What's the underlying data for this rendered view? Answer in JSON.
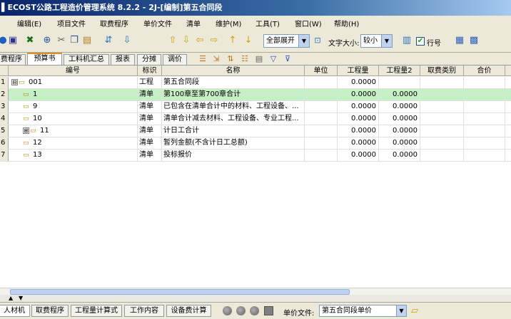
{
  "window": {
    "title": "▌ECOST公路工程造价管理系统 8.2.2 - 2J-[编制]第五合同段"
  },
  "menu": [
    {
      "label": "编辑(E)"
    },
    {
      "label": "项目文件"
    },
    {
      "label": "取费程序"
    },
    {
      "label": "单价文件"
    },
    {
      "label": "清单"
    },
    {
      "label": "维护(M)"
    },
    {
      "label": "工具(T)"
    },
    {
      "label": "窗口(W)"
    },
    {
      "label": "帮助(H)"
    }
  ],
  "toolbar": {
    "expand_select": "全部展开",
    "font_size_label": "文字大小:",
    "font_size_select": "较小",
    "line_number_label": "行号",
    "line_number_checked": "✔"
  },
  "tabs": [
    {
      "label": "费程序"
    },
    {
      "label": "预算书"
    },
    {
      "label": "工料机汇总"
    },
    {
      "label": "报表"
    },
    {
      "label": "分摊"
    },
    {
      "label": "调价"
    }
  ],
  "grid": {
    "columns": [
      "编号",
      "标识",
      "名称",
      "单位",
      "工程量",
      "工程量2",
      "取费类别",
      "合价"
    ],
    "rows": [
      {
        "rownum": "1",
        "code": "001",
        "kind": "工程",
        "name": "第五合同段",
        "unit": "",
        "qty": "0.0000",
        "qty2": "",
        "fee": "",
        "total": "",
        "expander": "⊟"
      },
      {
        "rownum": "2",
        "code": "1",
        "kind": "清单",
        "name": "第100章至第700章合计",
        "unit": "",
        "qty": "0.0000",
        "qty2": "0.0000",
        "fee": "",
        "total": "",
        "expander": ""
      },
      {
        "rownum": "3",
        "code": "9",
        "kind": "清单",
        "name": "已包含在清单合计中的材料、工程设备、...",
        "unit": "",
        "qty": "0.0000",
        "qty2": "0.0000",
        "fee": "",
        "total": "",
        "expander": ""
      },
      {
        "rownum": "4",
        "code": "10",
        "kind": "清单",
        "name": "清单合计减去材料、工程设备、专业工程...",
        "unit": "",
        "qty": "0.0000",
        "qty2": "0.0000",
        "fee": "",
        "total": "",
        "expander": ""
      },
      {
        "rownum": "5",
        "code": "11",
        "kind": "清单",
        "name": "计日工合计",
        "unit": "",
        "qty": "0.0000",
        "qty2": "0.0000",
        "fee": "",
        "total": "",
        "expander": "⊞"
      },
      {
        "rownum": "6",
        "code": "12",
        "kind": "清单",
        "name": "暂列金额(不含计日工总额)",
        "unit": "",
        "qty": "0.0000",
        "qty2": "0.0000",
        "fee": "",
        "total": "",
        "expander": ""
      },
      {
        "rownum": "7",
        "code": "13",
        "kind": "清单",
        "name": "投标报价",
        "unit": "",
        "qty": "0.0000",
        "qty2": "0.0000",
        "fee": "",
        "total": "",
        "expander": ""
      }
    ]
  },
  "bottom": {
    "tabs": [
      {
        "label": "人材机"
      },
      {
        "label": "取费程序"
      },
      {
        "label": "工程量计算式"
      },
      {
        "label": "工作内容"
      },
      {
        "label": "设备费计算"
      }
    ],
    "price_file_label": "单价文件:",
    "price_file_value": "第五合同段单价"
  }
}
